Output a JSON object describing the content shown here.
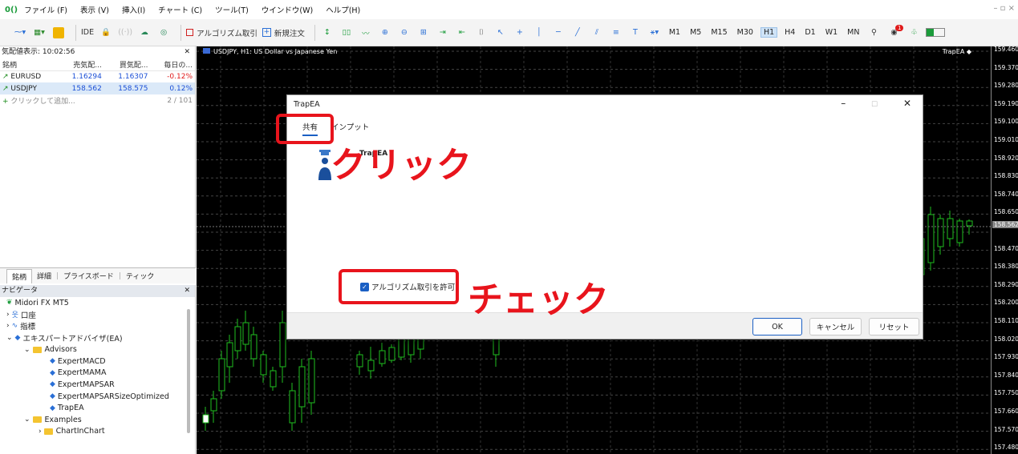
{
  "menu": {
    "items": [
      "ファイル (F)",
      "表示 (V)",
      "挿入(I)",
      "チャート (C)",
      "ツール(T)",
      "ウインドウ(W)",
      "ヘルプ(H)"
    ]
  },
  "toolbar": {
    "algo_trading": "アルゴリズム取引",
    "new_order": "新規注文",
    "ide": "IDE",
    "timeframes": [
      "M1",
      "M5",
      "M15",
      "M30",
      "H1",
      "H4",
      "D1",
      "W1",
      "MN"
    ],
    "active_timeframe": "H1",
    "notification_count": "1"
  },
  "market_watch": {
    "title": "気配値表示: 10:02:56",
    "columns": [
      "銘柄",
      "売気配...",
      "買気配...",
      "毎日の..."
    ],
    "rows": [
      {
        "symbol": "EURUSD",
        "bid": "1.16294",
        "ask": "1.16307",
        "change": "-0.12%"
      },
      {
        "symbol": "USDJPY",
        "bid": "158.562",
        "ask": "158.575",
        "change": "0.12%"
      }
    ],
    "add_row": "クリックして追加...",
    "count": "2 / 101",
    "tabs": [
      "銘柄",
      "詳細",
      "プライスボード",
      "ティック"
    ]
  },
  "navigator": {
    "title": "ナビゲータ",
    "account": "Midori FX MT5",
    "accounts": "口座",
    "indicators": "指標",
    "expert_advisors": "エキスパートアドバイザ(EA)",
    "advisors_folder": "Advisors",
    "experts": [
      "ExpertMACD",
      "ExpertMAMA",
      "ExpertMAPSAR",
      "ExpertMAPSARSizeOptimized",
      "TrapEA"
    ],
    "examples_folder": "Examples",
    "chartinchart": "ChartInChart"
  },
  "chart": {
    "title": "USDJPY, H1:  US Dollar vs Japanese Yen",
    "ea_label": "TrapEA",
    "price_labels": [
      "159.460",
      "159.370",
      "159.280",
      "159.190",
      "159.100",
      "159.010",
      "158.920",
      "158.830",
      "158.740",
      "158.650",
      "158.562",
      "158.470",
      "158.380",
      "158.290",
      "158.200",
      "158.110",
      "158.020",
      "157.930",
      "157.840",
      "157.750",
      "157.660",
      "157.570",
      "157.480"
    ],
    "current_price": "158.562"
  },
  "dialog": {
    "title": "TrapEA",
    "tabs": [
      "共有",
      "インプット"
    ],
    "ea_name": "TrapEA",
    "allow_algo_label": "アルゴリズム取引を許可",
    "allow_algo_checked": true,
    "ok": "OK",
    "cancel": "キャンセル",
    "reset": "リセット"
  },
  "annotations": {
    "click": "クリック",
    "check": "チェック",
    "color": "#e8141c"
  }
}
